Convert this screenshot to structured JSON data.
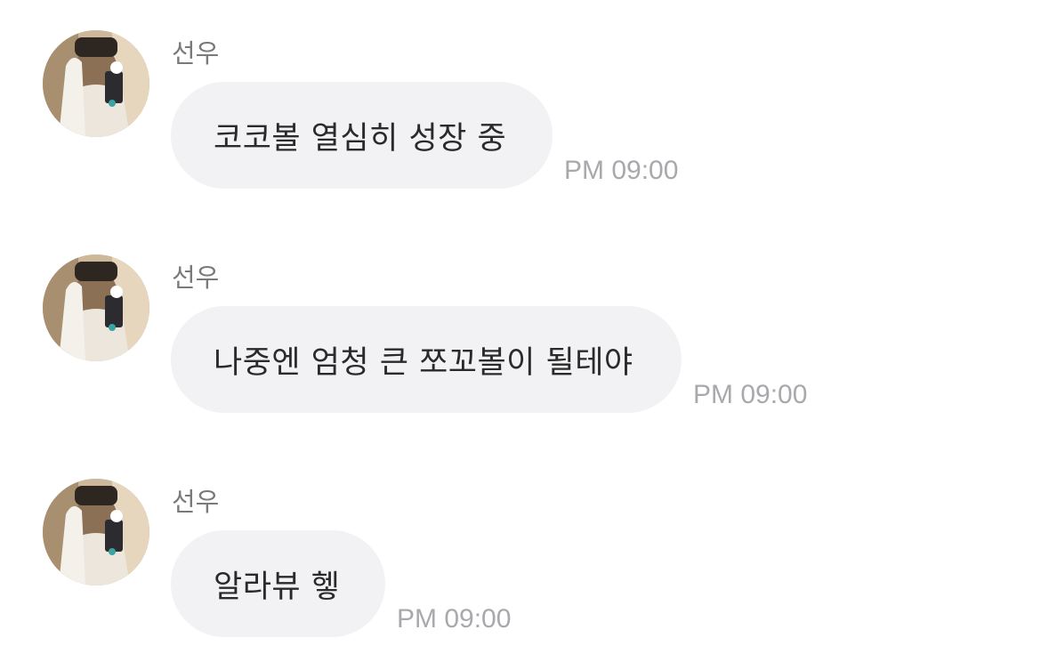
{
  "colors": {
    "bubble_background": "#f2f2f4",
    "sender_text": "#7a7a7a",
    "timestamp_text": "#a9a9ad",
    "message_text": "#2a2a2a"
  },
  "messages": [
    {
      "sender": "선우",
      "avatar_icon": "profile-photo",
      "text": "코코볼 열심히 성장 중",
      "time": "PM 09:00"
    },
    {
      "sender": "선우",
      "avatar_icon": "profile-photo",
      "text": "나중엔 엄청 큰 쪼꼬볼이 될테야",
      "time": "PM 09:00"
    },
    {
      "sender": "선우",
      "avatar_icon": "profile-photo",
      "text": "알라뷰 헿",
      "time": "PM 09:00"
    }
  ]
}
